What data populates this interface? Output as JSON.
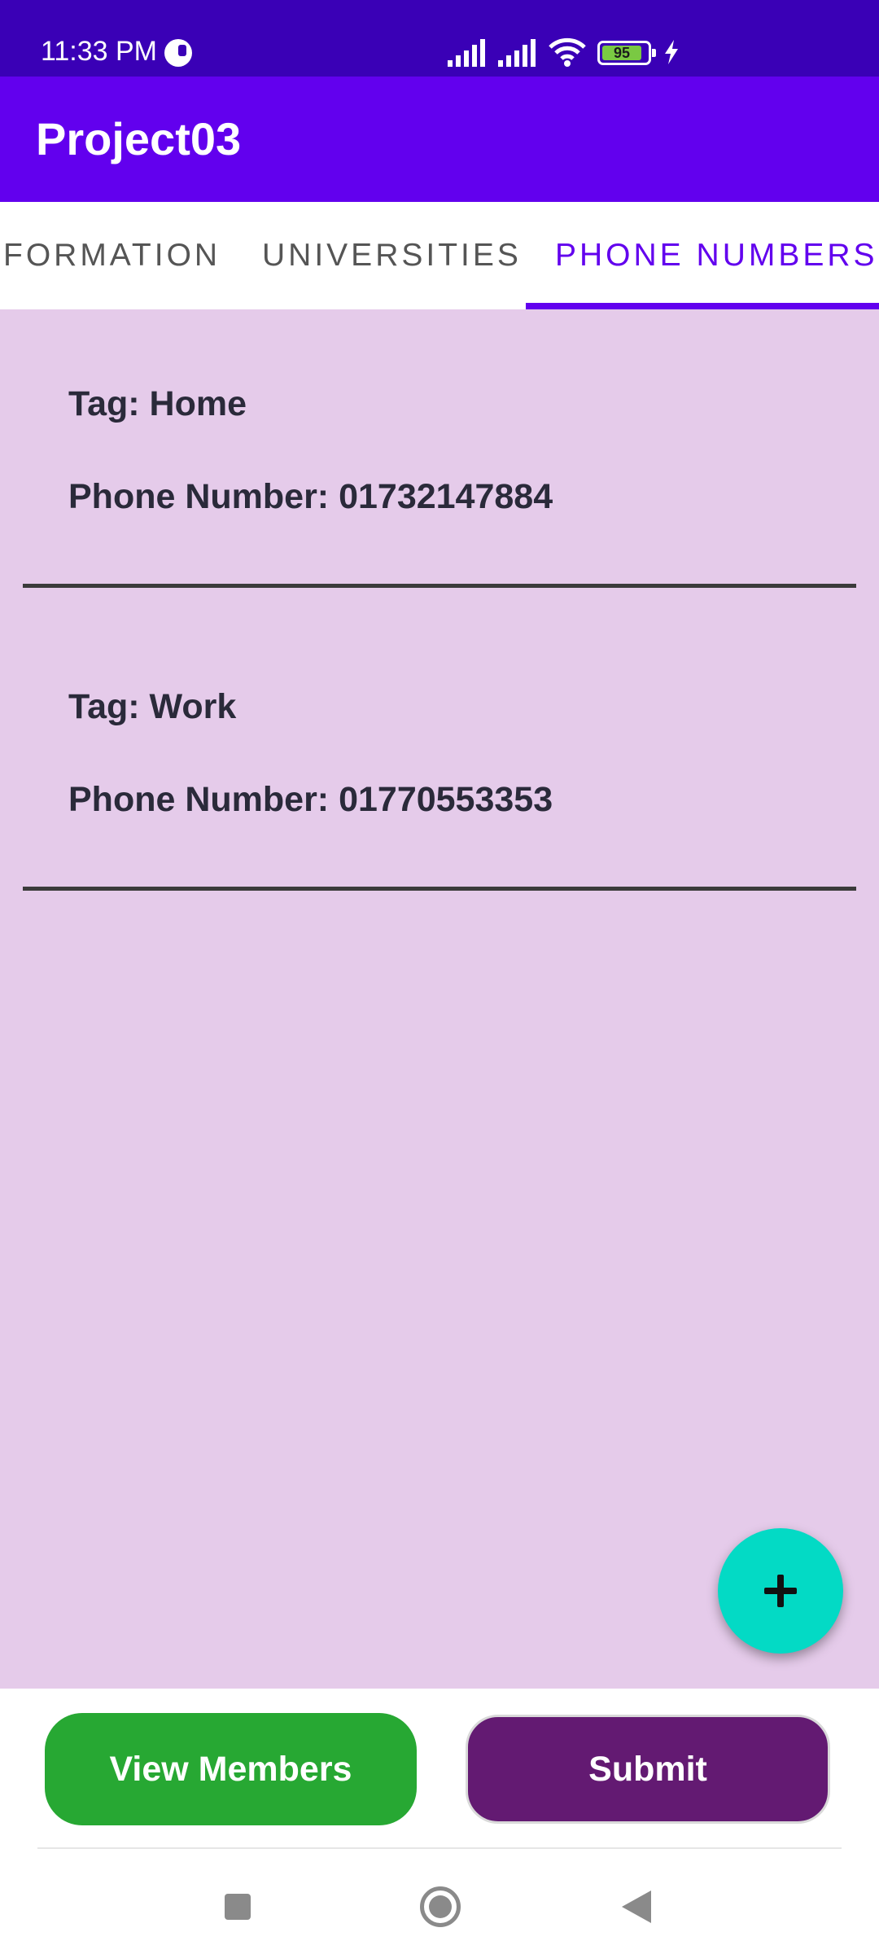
{
  "status_bar": {
    "time": "11:33 PM",
    "battery_level": "95",
    "icons": [
      "clock-app-icon",
      "signal-icon",
      "signal-icon",
      "wifi-icon",
      "battery-icon",
      "charging-bolt-icon"
    ]
  },
  "app_bar": {
    "title": "Project03"
  },
  "tabs": [
    {
      "label": "FORMATION",
      "active": false
    },
    {
      "label": "UNIVERSITIES",
      "active": false
    },
    {
      "label": "PHONE NUMBERS",
      "active": true
    }
  ],
  "phone_entries": [
    {
      "tag_text": "Tag: Home",
      "number_text": "Phone Number: 01732147884"
    },
    {
      "tag_text": "Tag: Work",
      "number_text": "Phone Number: 01770553353"
    }
  ],
  "fab": {
    "icon": "plus-icon"
  },
  "buttons": {
    "view_members": "View Members",
    "submit": "Submit"
  },
  "navigation": {
    "icons": [
      "recents-square-icon",
      "home-circle-icon",
      "back-triangle-icon"
    ]
  },
  "colors": {
    "status_bar": "#3a00b6",
    "app_bar": "#6200ee",
    "content_bg": "#e5cbea",
    "fab": "#03dac5",
    "view_members_button": "#27a833",
    "submit_button": "#631a72"
  }
}
